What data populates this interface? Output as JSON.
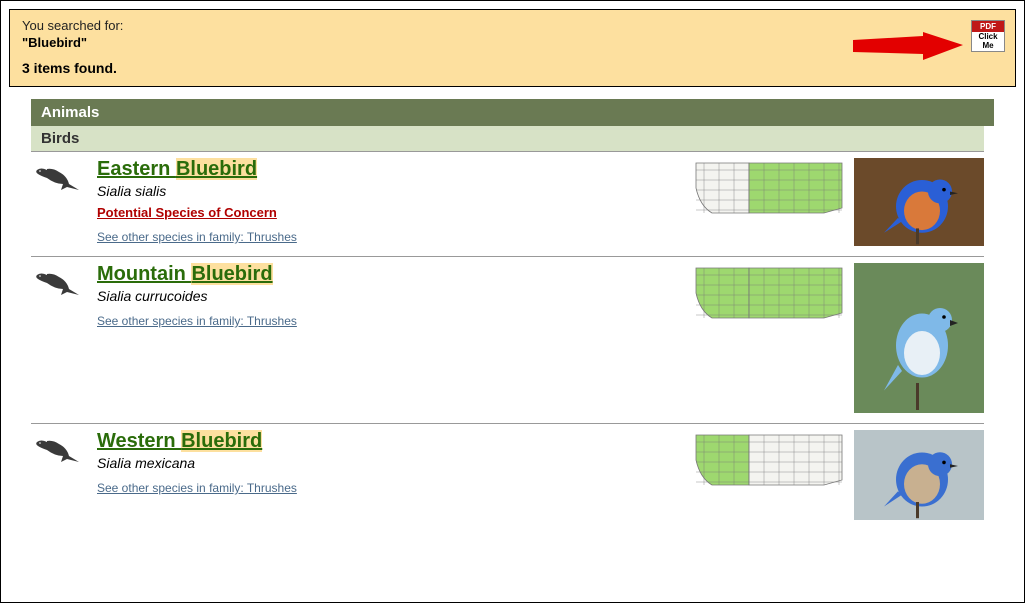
{
  "banner": {
    "label": "You searched for:",
    "query": "\"Bluebird\"",
    "count_text": "3 items found.",
    "pdf_top": "PDF",
    "pdf_click": "Click",
    "pdf_me": "Me"
  },
  "headers": {
    "kingdom": "Animals",
    "class": "Birds"
  },
  "highlight_term": "Bluebird",
  "results": [
    {
      "common_prefix": "Eastern ",
      "scientific": "Sialia sialis",
      "concern": "Potential Species of Concern",
      "family_link": "See other species in family: Thrushes",
      "map_style": "east",
      "photo_style": "eastern",
      "photo_h": 88
    },
    {
      "common_prefix": "Mountain ",
      "scientific": "Sialia currucoides",
      "concern": "",
      "family_link": "See other species in family: Thrushes",
      "map_style": "full",
      "photo_style": "mountain",
      "photo_h": 150
    },
    {
      "common_prefix": "Western ",
      "scientific": "Sialia mexicana",
      "concern": "",
      "family_link": "See other species in family: Thrushes",
      "map_style": "west",
      "photo_style": "western",
      "photo_h": 90
    }
  ]
}
